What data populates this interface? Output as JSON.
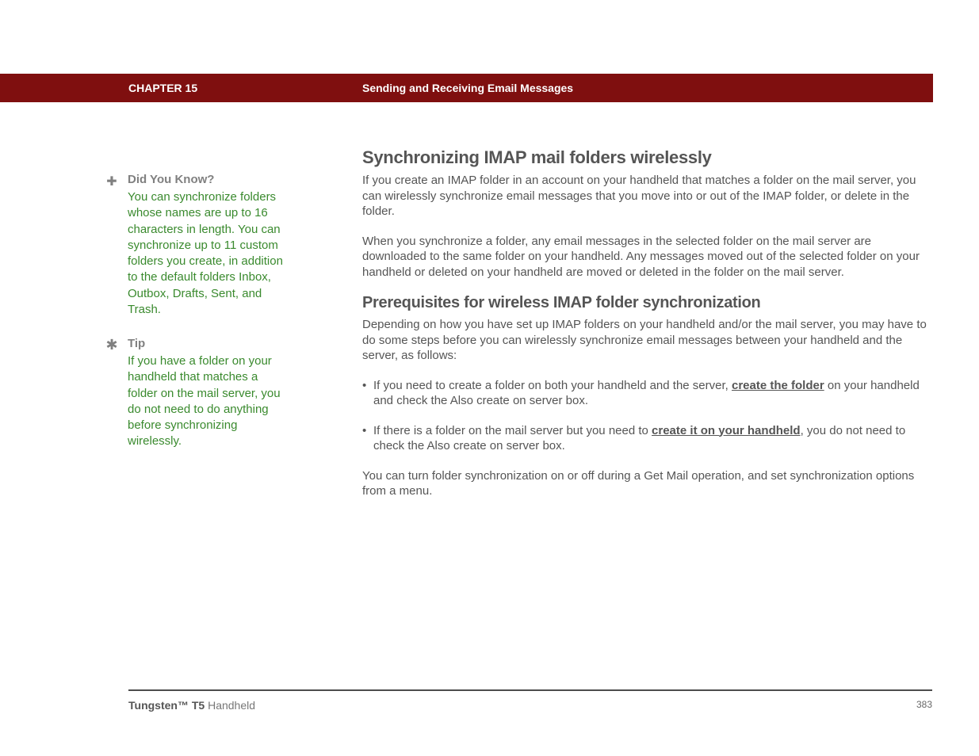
{
  "header": {
    "chapter": "CHAPTER 15",
    "title": "Sending and Receiving Email Messages"
  },
  "sidebar": {
    "didyouknow": {
      "title": "Did You Know?",
      "body": "You can synchronize folders whose names are up to 16 characters in length. You can synchronize up to 11 custom folders you create, in addition to the default folders Inbox, Outbox, Drafts, Sent, and Trash."
    },
    "tip": {
      "title": "Tip",
      "body": "If you have a folder on your handheld that matches a folder on the mail server, you do not need to do anything before synchronizing wirelessly."
    }
  },
  "main": {
    "h2": "Synchronizing IMAP mail folders wirelessly",
    "p1": "If you create an IMAP folder in an account on your handheld that matches a folder on the mail server, you can wirelessly synchronize email messages that you move into or out of the IMAP folder, or delete in the folder.",
    "p2": "When you synchronize a folder, any email messages in the selected folder on the mail server are downloaded to the same folder on your handheld. Any messages moved out of the selected folder on your handheld or deleted on your handheld are moved or deleted in the folder on the mail server.",
    "h3": "Prerequisites for wireless IMAP folder synchronization",
    "p3": "Depending on how you have set up IMAP folders on your handheld and/or the mail server, you may have to do some steps before you can wirelessly synchronize email messages between your handheld and the server, as follows:",
    "li1_a": "If you need to create a folder on both your handheld and the server, ",
    "li1_link": "create the folder",
    "li1_b": " on your handheld and check the Also create on server box.",
    "li2_a": "If there is a folder on the mail server but you need to ",
    "li2_link": "create it on your handheld",
    "li2_b": ", you do not need to check the Also create on server box.",
    "p4": "You can turn folder synchronization on or off during a Get Mail operation, and set synchronization options from a menu."
  },
  "footer": {
    "product_bold": "Tungsten™ T5",
    "product_rest": " Handheld",
    "page": "383"
  }
}
